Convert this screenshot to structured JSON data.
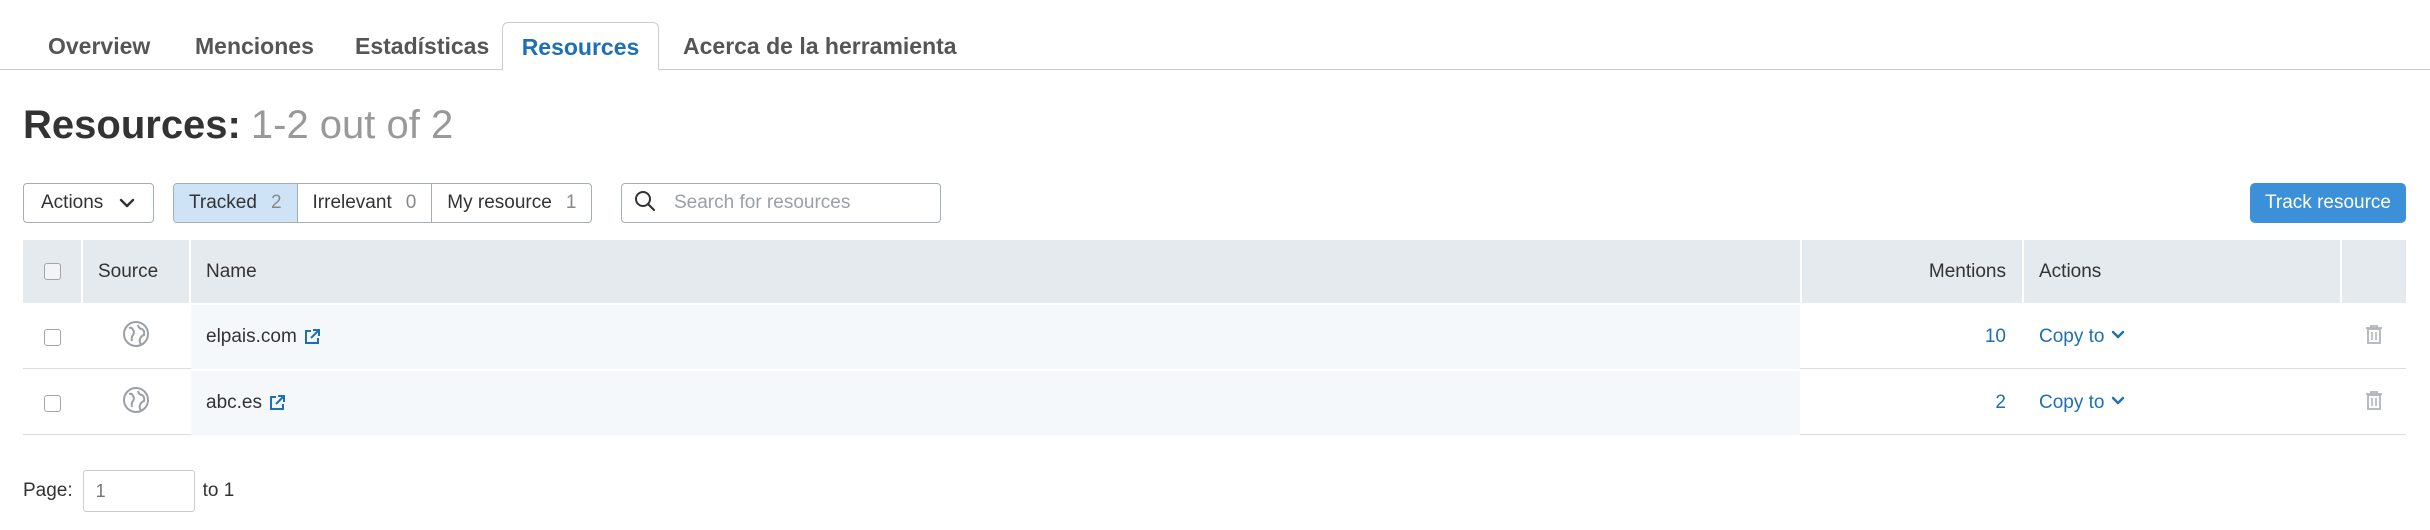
{
  "tabs": [
    {
      "label": "Overview",
      "active": false
    },
    {
      "label": "Menciones",
      "active": false
    },
    {
      "label": "Estadísticas",
      "active": false
    },
    {
      "label": "Resources",
      "active": true
    },
    {
      "label": "Acerca de la herramienta",
      "active": false
    }
  ],
  "title": {
    "main": "Resources:",
    "count": "1-2 out of 2"
  },
  "toolbar": {
    "actions_label": "Actions",
    "filters": [
      {
        "label": "Tracked",
        "count": "2",
        "active": true
      },
      {
        "label": "Irrelevant",
        "count": "0",
        "active": false
      },
      {
        "label": "My resource",
        "count": "1",
        "active": false
      }
    ],
    "search_placeholder": "Search for resources",
    "track_label": "Track resource"
  },
  "table": {
    "headers": {
      "source": "Source",
      "name": "Name",
      "mentions": "Mentions",
      "actions": "Actions"
    },
    "rows": [
      {
        "name": "elpais.com",
        "mentions": "10",
        "action": "Copy to"
      },
      {
        "name": "abc.es",
        "mentions": "2",
        "action": "Copy to"
      }
    ]
  },
  "pagination": {
    "label": "Page:",
    "value": "1",
    "suffix": "to 1"
  },
  "colors": {
    "accent": "#3b90d8",
    "link": "#1f6fb4",
    "header_bg": "#e4eaee",
    "active_filter": "#cfe3f7"
  },
  "icons": [
    "chevron-down-icon",
    "search-icon",
    "globe-icon",
    "external-link-icon",
    "trash-icon"
  ]
}
